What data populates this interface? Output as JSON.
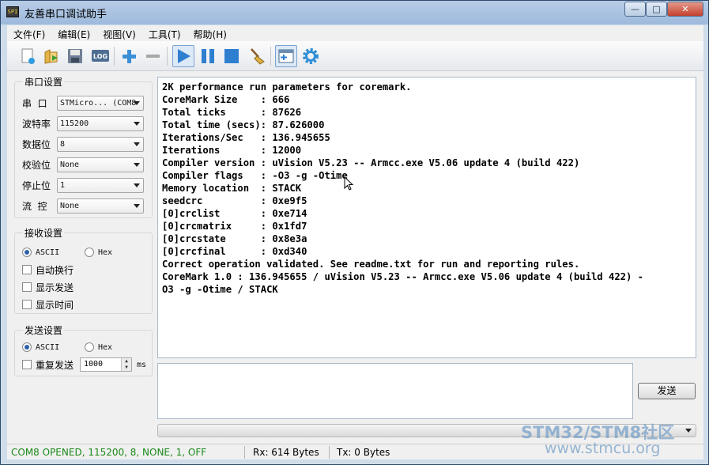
{
  "window": {
    "title": "友善串口调试助手",
    "app_icon_text": "SPI",
    "controls": [
      "—",
      "□",
      "✕"
    ]
  },
  "menu": [
    "文件(F)",
    "编辑(E)",
    "视图(V)",
    "工具(T)",
    "帮助(H)"
  ],
  "toolbar_icons": [
    "new-icon",
    "open-icon",
    "save-icon",
    "log-icon",
    "add-icon",
    "remove-icon",
    "play-icon",
    "pause-icon",
    "stop-icon",
    "clear-broom-icon",
    "new-window-icon",
    "settings-gear-icon"
  ],
  "serial_settings": {
    "title": "串口设置",
    "rows": [
      {
        "label": "串  口",
        "value": "STMicro... (COM8"
      },
      {
        "label": "波特率",
        "value": "115200"
      },
      {
        "label": "数据位",
        "value": "8"
      },
      {
        "label": "校验位",
        "value": "None"
      },
      {
        "label": "停止位",
        "value": "1"
      },
      {
        "label": "流  控",
        "value": "None"
      }
    ]
  },
  "receive_settings": {
    "title": "接收设置",
    "ascii_label": "ASCII",
    "hex_label": "Hex",
    "auto_wrap": "自动换行",
    "show_send": "显示发送",
    "show_time": "显示时间"
  },
  "send_settings": {
    "title": "发送设置",
    "ascii_label": "ASCII",
    "hex_label": "Hex",
    "repeat_label": "重复发送",
    "interval_value": "1000",
    "interval_unit": "ms"
  },
  "receive_lines": [
    "2K performance run parameters for coremark.",
    "CoreMark Size    : 666",
    "Total ticks      : 87626",
    "Total time (secs): 87.626000",
    "Iterations/Sec   : 136.945655",
    "Iterations       : 12000",
    "Compiler version : uVision V5.23 -- Armcc.exe V5.06 update 4 (build 422)",
    "Compiler flags   : -O3 -g -Otime",
    "Memory location  : STACK",
    "seedcrc          : 0xe9f5",
    "[0]crclist       : 0xe714",
    "[0]crcmatrix     : 0x1fd7",
    "[0]crcstate      : 0x8e3a",
    "[0]crcfinal      : 0xd340",
    "Correct operation validated. See readme.txt for run and reporting rules.",
    "CoreMark 1.0 : 136.945655 / uVision V5.23 -- Armcc.exe V5.06 update 4 (build 422) -",
    "O3 -g -Otime / STACK"
  ],
  "send_button_label": "发送",
  "status": {
    "connection": "COM8 OPENED, 115200, 8, NONE, 1, OFF",
    "rx": "Rx: 614 Bytes",
    "tx": "Tx: 0 Bytes",
    "connection_color": "#1a8a1a"
  },
  "watermark": {
    "line1": "STM32/STM8社区",
    "line2": "www.stmcu.org"
  }
}
